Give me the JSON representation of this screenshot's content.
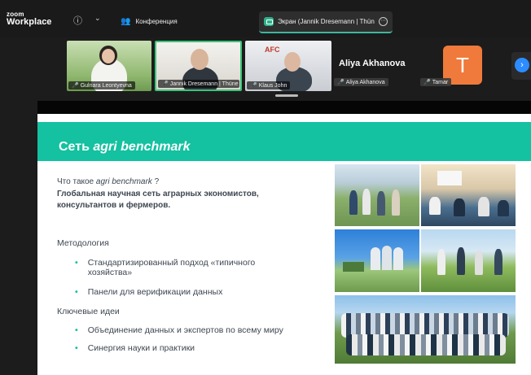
{
  "app": {
    "logo_line1": "zoom",
    "logo_line2": "Workplace",
    "info_icon": "info-icon",
    "chevron_icon": "chevron-down-icon"
  },
  "tabs": {
    "meeting_label": "Конференция",
    "share_label": "Экран (Jannik Dresemann | Thün",
    "share_more_icon": "more-icon"
  },
  "participants": [
    {
      "name": "Gulnara Leontyevna",
      "muted": true
    },
    {
      "name": "Jannik Dresemann | Thüne",
      "muted": true,
      "active": true
    },
    {
      "name": "Klaus John",
      "muted": true,
      "logo_text": "AFC"
    },
    {
      "name": "Aliya Akhanova",
      "display_name": "Aliya Akhanova",
      "muted": true
    },
    {
      "name": "Tamar",
      "initial": "T",
      "muted": true
    }
  ],
  "slide": {
    "title_prefix": "Сеть ",
    "title_italic": "agri benchmark",
    "question_prefix": "Что такое ",
    "question_italic": "agri benchmark",
    "question_suffix": " ?",
    "definition_line1": "Глобальная научная сеть аграрных экономистов,",
    "definition_line2": "консультантов и фермеров.",
    "section1": "Методология",
    "bullet1_line1": "Стандартизированный подход «типичного",
    "bullet1_line2": "хозяйства»",
    "bullet2": "Панели для верификации данных",
    "section2": "Ключевые идеи",
    "bullet3": "Объединение данных и экспертов по всему миру",
    "bullet4": "Синергия науки и практики"
  },
  "colors": {
    "accent_teal": "#14c1a0",
    "active_speaker_border": "#3bc47a",
    "tamar_avatar": "#ef7a3b",
    "next_button": "#2d8cff",
    "muted_mic": "#e04545"
  }
}
